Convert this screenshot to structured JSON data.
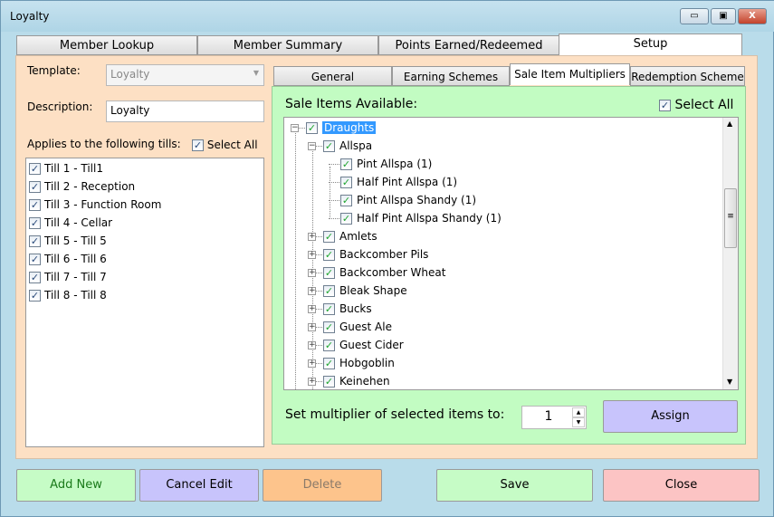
{
  "window": {
    "title": "Loyalty",
    "minimize": "▭",
    "maximize": "▣",
    "close": "X"
  },
  "tabs": [
    {
      "label": "Member Lookup"
    },
    {
      "label": "Member Summary"
    },
    {
      "label": "Points Earned/Redeemed"
    },
    {
      "label": "Setup",
      "active": true
    }
  ],
  "setup": {
    "template_label": "Template:",
    "template_value": "Loyalty",
    "description_label": "Description:",
    "description_value": "Loyalty",
    "tills_label": "Applies to the following tills:",
    "select_all": "Select All",
    "tills": [
      "Till 1 - Till1",
      "Till 2 - Reception",
      "Till 3 - Function Room",
      "Till 4 - Cellar",
      "Till 5 - Till 5",
      "Till 6 - Till 6",
      "Till 7 - Till 7",
      "Till 8 - Till 8"
    ]
  },
  "subtabs": [
    {
      "label": "General"
    },
    {
      "label": "Earning Schemes"
    },
    {
      "label": "Sale Item Multipliers",
      "active": true
    },
    {
      "label": "Redemption Scheme"
    }
  ],
  "multipliers": {
    "available_label": "Sale Items Available:",
    "select_all": "Select All",
    "tree": [
      {
        "label": "Draughts",
        "level": 0,
        "expanded": true,
        "selected": true
      },
      {
        "label": "Allspa",
        "level": 1,
        "expanded": true
      },
      {
        "label": "Pint Allspa (1)",
        "level": 2
      },
      {
        "label": "Half Pint Allspa (1)",
        "level": 2
      },
      {
        "label": "Pint Allspa Shandy (1)",
        "level": 2
      },
      {
        "label": "Half Pint Allspa Shandy (1)",
        "level": 2
      },
      {
        "label": "Amlets",
        "level": 1
      },
      {
        "label": "Backcomber Pils",
        "level": 1
      },
      {
        "label": "Backcomber Wheat",
        "level": 1
      },
      {
        "label": "Bleak Shape",
        "level": 1
      },
      {
        "label": "Bucks",
        "level": 1
      },
      {
        "label": "Guest Ale",
        "level": 1
      },
      {
        "label": "Guest Cider",
        "level": 1
      },
      {
        "label": "Hobgoblin",
        "level": 1
      },
      {
        "label": "Keinehen",
        "level": 1
      }
    ],
    "set_label": "Set multiplier of selected items to:",
    "multiplier_value": "1",
    "assign": "Assign"
  },
  "buttons": {
    "add_new": "Add New",
    "cancel_edit": "Cancel Edit",
    "delete": "Delete",
    "save": "Save",
    "close": "Close"
  },
  "colors": {
    "setup_bg": "#fde0c4",
    "green_panel": "#c2fcc2",
    "add": "#c6fcc6",
    "cancel": "#c8c4fc",
    "delete": "#fdc48c",
    "save": "#c6fcc6",
    "close": "#fcc4c4",
    "selection": "#3399ff"
  }
}
